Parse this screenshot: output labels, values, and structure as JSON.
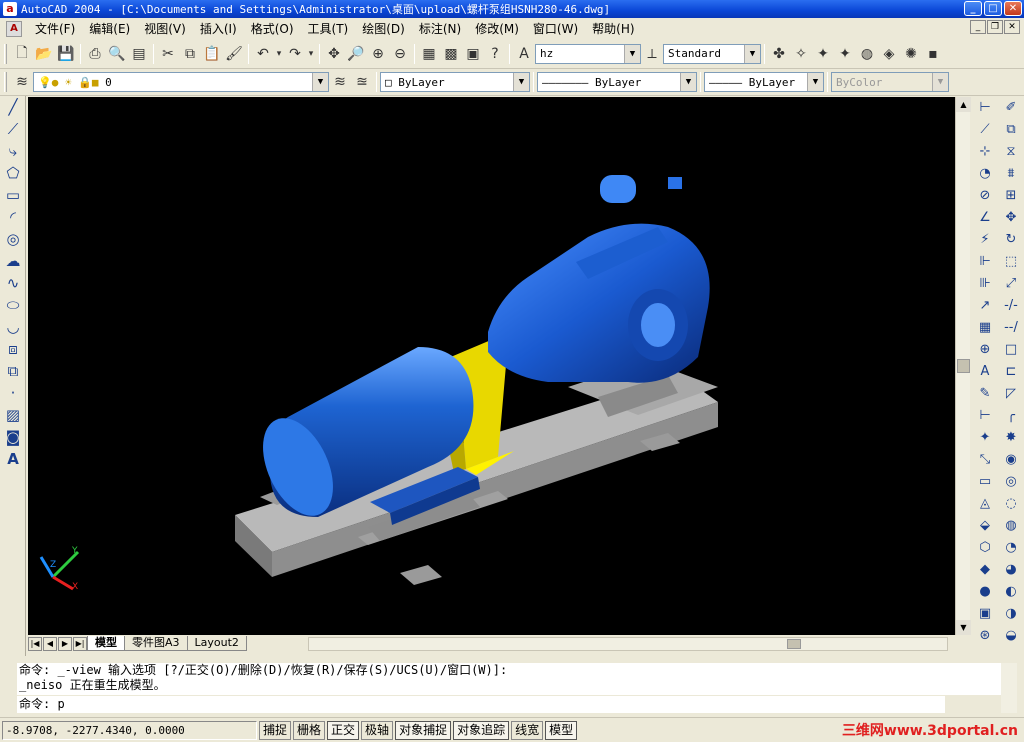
{
  "window": {
    "title": "AutoCAD 2004 - [C:\\Documents and Settings\\Administrator\\桌面\\upload\\螺杆泵组HSNH280-46.dwg]",
    "app_icon_label": "a",
    "controls": [
      "minimize",
      "maximize",
      "close"
    ]
  },
  "menubar": {
    "items": [
      "文件(F)",
      "编辑(E)",
      "视图(V)",
      "插入(I)",
      "格式(O)",
      "工具(T)",
      "绘图(D)",
      "标注(N)",
      "修改(M)",
      "窗口(W)",
      "帮助(H)"
    ]
  },
  "toolbar_standard": {
    "text_style": "hz",
    "dim_style": "Standard"
  },
  "toolbar_layers": {
    "layer_name": "0",
    "color": "ByLayer",
    "linetype": "ByLayer",
    "lineweight": "ByLayer",
    "plot_style": "ByColor"
  },
  "draw_toolbar": {
    "items": [
      "line-icon",
      "construction-line-icon",
      "polyline-icon",
      "polygon-icon",
      "rectangle-icon",
      "arc-icon",
      "circle-icon",
      "revision-cloud-icon",
      "spline-icon",
      "ellipse-icon",
      "ellipse-arc-icon",
      "insert-block-icon",
      "make-block-icon",
      "point-icon",
      "hatch-icon",
      "region-icon",
      "multiline-text-icon"
    ],
    "text_glyph": "A"
  },
  "viewport": {
    "background": "#000000",
    "motor_color": "#1e64d2",
    "coupling_color": "#f0e000",
    "base_color": "#9a9a9a",
    "ucs": {
      "x": "X",
      "y": "Y",
      "z": "Z"
    }
  },
  "layout_tabs": {
    "tabs": [
      "模型",
      "零件图A3",
      "Layout2"
    ],
    "active": "模型"
  },
  "command": {
    "history": [
      "命令: _-view 输入选项 [?/正交(O)/删除(D)/恢复(R)/保存(S)/UCS(U)/窗口(W)]:",
      "_neiso 正在重生成模型。"
    ],
    "prompt": "命令: p"
  },
  "statusbar": {
    "coords": "-8.9708,   -2277.4340, 0.0000",
    "toggles": [
      "捕捉",
      "栅格",
      "正交",
      "极轴",
      "对象捕捉",
      "对象追踪",
      "线宽",
      "模型"
    ],
    "watermark": "三维网www.3dportal.cn"
  }
}
